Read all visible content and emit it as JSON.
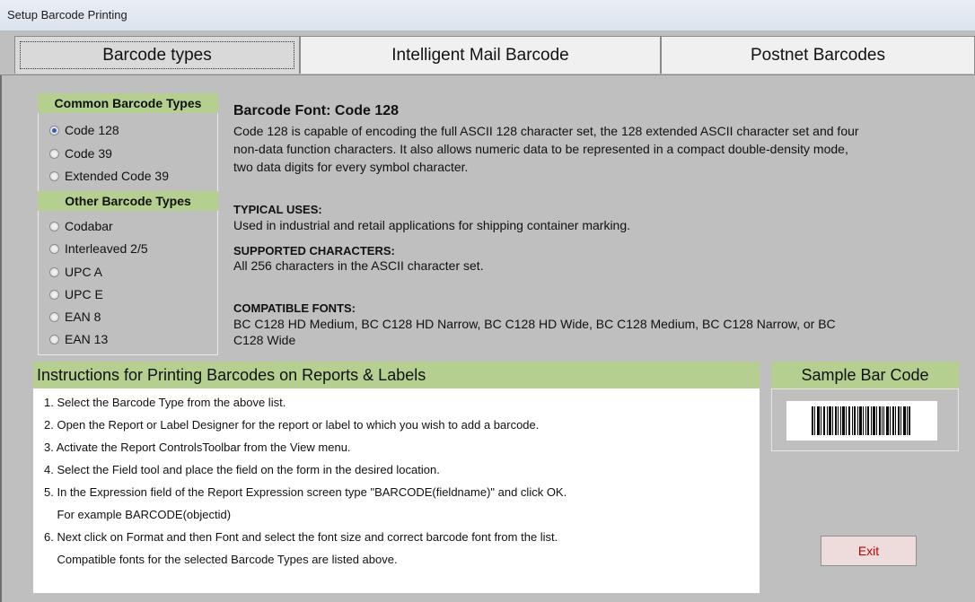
{
  "window": {
    "title": "Setup Barcode Printing"
  },
  "tabs": [
    {
      "label": "Barcode types"
    },
    {
      "label": "Intelligent Mail Barcode"
    },
    {
      "label": "Postnet Barcodes"
    }
  ],
  "common_types": {
    "header": "Common Barcode Types",
    "items": [
      "Code 128",
      "Code 39",
      "Extended Code 39"
    ]
  },
  "other_types": {
    "header": "Other Barcode Types",
    "items": [
      "Codabar",
      "Interleaved 2/5",
      "UPC A",
      "UPC E",
      "EAN 8",
      "EAN 13"
    ]
  },
  "selected_type": "Code 128",
  "description": {
    "title": "Barcode Font: Code 128",
    "body_lines": [
      "Code 128 is capable of encoding the full ASCII 128 character set, the 128 extended ASCII character set and four",
      "non-data function characters.  It also allows numeric data to be represented in a compact double-density mode,",
      "two data digits for every symbol character."
    ],
    "typical_uses_label": "TYPICAL USES:",
    "typical_uses": "Used in industrial and retail applications for shipping container marking.",
    "supported_label": "SUPPORTED CHARACTERS:",
    "supported": "All 256 characters in the ASCII character set.",
    "compatible_label": "COMPATIBLE FONTS:",
    "compatible_lines": [
      "BC C128 HD Medium, BC C128 HD Narrow, BC C128 HD Wide, BC C128 Medium, BC C128 Narrow, or BC",
      "C128 Wide"
    ]
  },
  "instructions": {
    "header": "Instructions for Printing Barcodes on Reports & Labels",
    "lines": [
      "1. Select the Barcode Type from the above list.",
      "2. Open the Report or Label Designer for the report or label to which you wish to add a barcode.",
      "3. Activate the Report ControlsToolbar from the View menu.",
      "4. Select the Field tool and place the field on the form in the desired location.",
      "5. In the Expression field of the Report Expression screen type \"BARCODE(fieldname)\" and click OK.",
      "    For example BARCODE(objectid)",
      "6. Next click on Format and then Font and select the font size and correct barcode font from the list.",
      "    Compatible fonts for the selected Barcode Types are listed above."
    ]
  },
  "sample": {
    "header": "Sample Bar Code"
  },
  "buttons": {
    "exit": "Exit"
  },
  "colors": {
    "section_header": "#b4cf8f",
    "exit_text": "#c00000",
    "radio_selected": "#2a62b8"
  }
}
